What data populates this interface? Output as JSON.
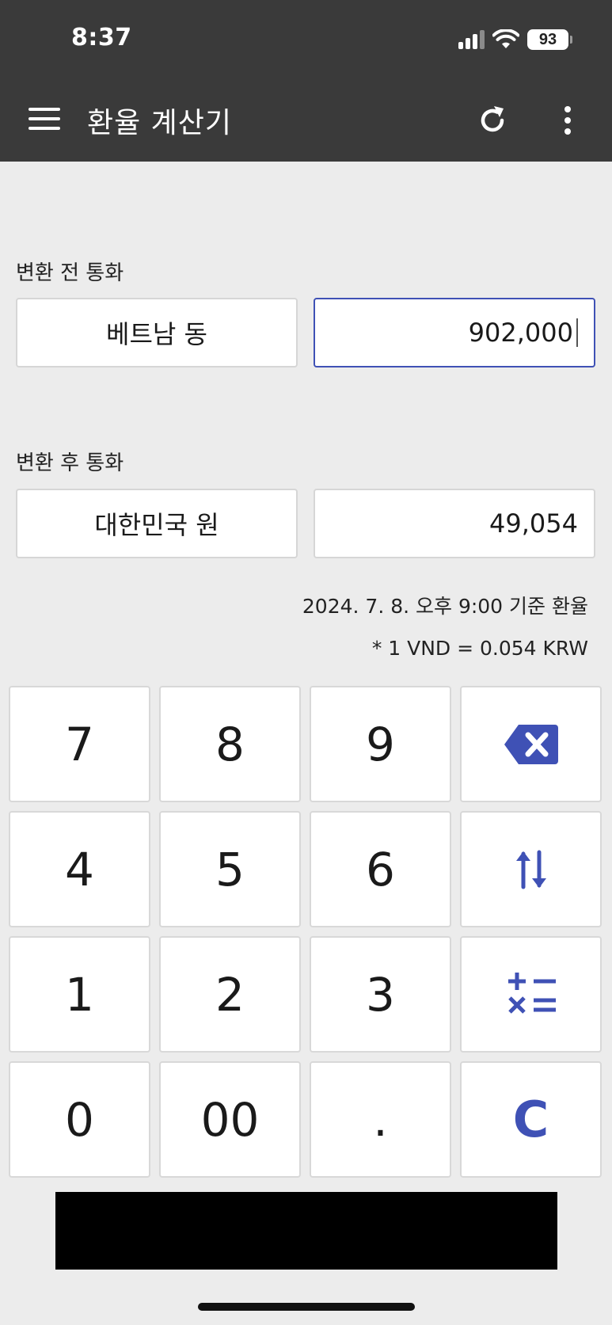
{
  "status_bar": {
    "time": "8:37",
    "battery": "93"
  },
  "app_bar": {
    "title": "환율 계산기",
    "icons": [
      "menu-icon",
      "refresh-icon",
      "more-vert-icon"
    ]
  },
  "from": {
    "label": "변환 전 통화",
    "currency": "베트남 동",
    "amount": "902,000"
  },
  "to": {
    "label": "변환 후 통화",
    "currency": "대한민국 원",
    "amount": "49,054"
  },
  "rate": {
    "date_text": "2024. 7. 8. 오후 9:00 기준 환율",
    "rate_text": "* 1 VND = 0.054 KRW"
  },
  "keypad": {
    "k7": "7",
    "k8": "8",
    "k9": "9",
    "k4": "4",
    "k5": "5",
    "k6": "6",
    "k1": "1",
    "k2": "2",
    "k3": "3",
    "k0": "0",
    "k00": "00",
    "kdot": ".",
    "clear": "C"
  },
  "colors": {
    "accent": "#3f51b5",
    "app_bar": "#3a3a3a",
    "background": "#ececec"
  }
}
